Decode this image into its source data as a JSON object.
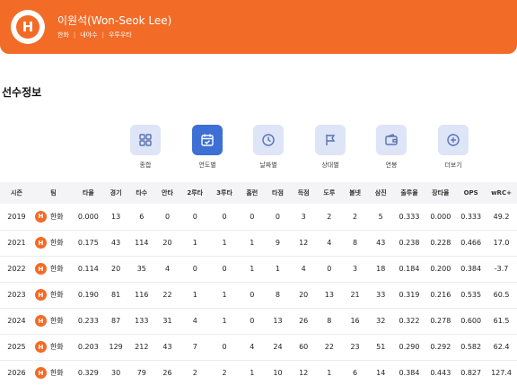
{
  "header": {
    "logo_letter": "H",
    "player_name": "이원석(Won-Seok Lee)",
    "team": "한화",
    "position": "내야수",
    "handedness": "우투우타"
  },
  "section_title": "선수정보",
  "tabs": [
    {
      "label": "종합",
      "icon": "grid-icon"
    },
    {
      "label": "연도별",
      "icon": "calendar-check-icon",
      "active": true
    },
    {
      "label": "날짜별",
      "icon": "clock-icon"
    },
    {
      "label": "상대별",
      "icon": "flag-icon"
    },
    {
      "label": "연봉",
      "icon": "wallet-icon"
    },
    {
      "label": "더보기",
      "icon": "plus-circle-icon"
    }
  ],
  "table": {
    "columns": [
      "시즌",
      "팀",
      "타율",
      "경기",
      "타수",
      "안타",
      "2루타",
      "3루타",
      "홈런",
      "타점",
      "득점",
      "도루",
      "볼넷",
      "삼진",
      "출루율",
      "장타율",
      "OPS",
      "wRC+"
    ],
    "rows": [
      {
        "season": "2019",
        "team": "한화",
        "cells": [
          "0.000",
          "13",
          "6",
          "0",
          "0",
          "0",
          "0",
          "0",
          "3",
          "2",
          "2",
          "5",
          "0.333",
          "0.000",
          "0.333",
          "49.2"
        ]
      },
      {
        "season": "2021",
        "team": "한화",
        "cells": [
          "0.175",
          "43",
          "114",
          "20",
          "1",
          "1",
          "1",
          "9",
          "12",
          "4",
          "8",
          "43",
          "0.238",
          "0.228",
          "0.466",
          "17.0"
        ]
      },
      {
        "season": "2022",
        "team": "한화",
        "cells": [
          "0.114",
          "20",
          "35",
          "4",
          "0",
          "0",
          "1",
          "1",
          "4",
          "0",
          "3",
          "18",
          "0.184",
          "0.200",
          "0.384",
          "-3.7"
        ]
      },
      {
        "season": "2023",
        "team": "한화",
        "cells": [
          "0.190",
          "81",
          "116",
          "22",
          "1",
          "1",
          "0",
          "8",
          "20",
          "13",
          "21",
          "33",
          "0.319",
          "0.216",
          "0.535",
          "60.5"
        ]
      },
      {
        "season": "2024",
        "team": "한화",
        "cells": [
          "0.233",
          "87",
          "133",
          "31",
          "4",
          "1",
          "0",
          "13",
          "26",
          "8",
          "16",
          "32",
          "0.322",
          "0.278",
          "0.600",
          "61.5"
        ]
      },
      {
        "season": "2025",
        "team": "한화",
        "cells": [
          "0.203",
          "129",
          "212",
          "43",
          "7",
          "0",
          "4",
          "24",
          "60",
          "22",
          "23",
          "51",
          "0.290",
          "0.292",
          "0.582",
          "62.4"
        ]
      },
      {
        "season": "2026",
        "team": "한화",
        "cells": [
          "0.329",
          "30",
          "79",
          "26",
          "2",
          "2",
          "1",
          "10",
          "12",
          "1",
          "6",
          "14",
          "0.384",
          "0.443",
          "0.827",
          "127.4"
        ]
      }
    ]
  },
  "colors": {
    "brand": "#f26b27",
    "tab_active": "#3d6fd4",
    "tab_inactive": "#dde5f7"
  }
}
